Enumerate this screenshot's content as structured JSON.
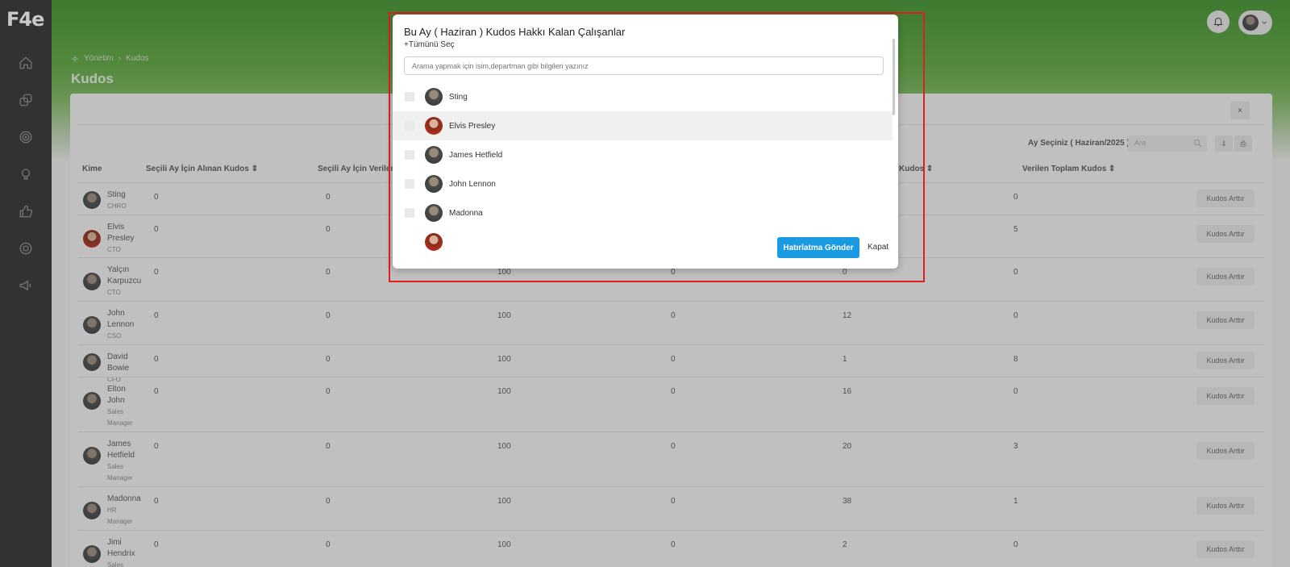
{
  "app": {
    "logo_text": "F4e"
  },
  "breadcrumb": {
    "root": "Yönetim",
    "current": "Kudos"
  },
  "page_title": "Kudos",
  "toolbar": {
    "month_label": "Ay Seçiniz ( Haziran/2025 )",
    "search_placeholder": "Ara",
    "close": "×"
  },
  "table": {
    "headers": [
      "Kime",
      "Seçili Ay İçin Alınan Kudos",
      "Seçili Ay İçin Verilen",
      "Kudos",
      "Verilen Toplam Kudos"
    ],
    "action_label": "Kudos Arttır",
    "rows": [
      {
        "name": "Sting",
        "role": "CHRO",
        "c1": "0",
        "c2": "0",
        "c3": "",
        "c4": "",
        "c5": "",
        "c6": "0"
      },
      {
        "name": "Elvis Presley",
        "role": "CTO",
        "c1": "0",
        "c2": "0",
        "c3": "",
        "c4": "",
        "c5": "",
        "c6": "5"
      },
      {
        "name": "Yalçın Karpuzcu",
        "role": "CTO",
        "c1": "0",
        "c2": "0",
        "c3": "100",
        "c4": "0",
        "c5": "0",
        "c6": "0"
      },
      {
        "name": "John Lennon",
        "role": "CSO",
        "c1": "0",
        "c2": "0",
        "c3": "100",
        "c4": "0",
        "c5": "12",
        "c6": "0"
      },
      {
        "name": "David Bowie",
        "role": "CFO",
        "c1": "0",
        "c2": "0",
        "c3": "100",
        "c4": "0",
        "c5": "1",
        "c6": "8"
      },
      {
        "name": "Elton John",
        "role": "Sales Manager",
        "c1": "0",
        "c2": "0",
        "c3": "100",
        "c4": "0",
        "c5": "16",
        "c6": "0"
      },
      {
        "name": "James Hetfield",
        "role": "Sales Manager",
        "c1": "0",
        "c2": "0",
        "c3": "100",
        "c4": "0",
        "c5": "20",
        "c6": "3"
      },
      {
        "name": "Madonna",
        "role": "HR Manager",
        "c1": "0",
        "c2": "0",
        "c3": "100",
        "c4": "0",
        "c5": "38",
        "c6": "1"
      },
      {
        "name": "Jimi Hendrix",
        "role": "Sales",
        "c1": "0",
        "c2": "0",
        "c3": "100",
        "c4": "0",
        "c5": "2",
        "c6": "0"
      }
    ]
  },
  "modal": {
    "title": "Bu Ay ( Haziran ) Kudos Hakkı Kalan Çalışanlar",
    "select_all": "+Tümünü Seç",
    "search_placeholder": "Arama yapmak için isim,departman gibi bilgileri yazınız",
    "employees": [
      "Sting",
      "Elvis Presley",
      "James Hetfield",
      "John Lennon",
      "Madonna"
    ],
    "send_button": "Hatırlatma Gönder",
    "close_link": "Kapat"
  }
}
